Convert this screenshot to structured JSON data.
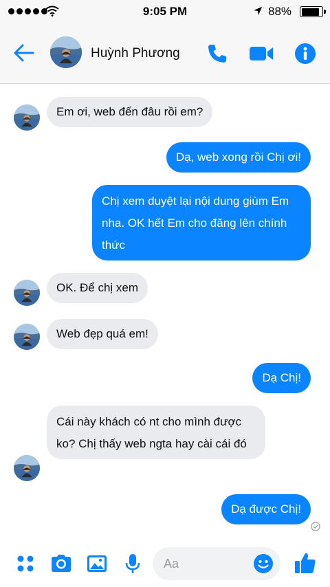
{
  "status_bar": {
    "time": "9:05 PM",
    "battery": "88%"
  },
  "header": {
    "contact_name": "Huỳnh Phương"
  },
  "messages": [
    {
      "direction": "in",
      "text": "Em ơi, web đến đâu rồi em?"
    },
    {
      "direction": "out",
      "text": "Dạ, web xong rồi Chị ơi!"
    },
    {
      "direction": "out",
      "text": "Chị xem duyệt lại nội dung giùm Em nha. OK hết Em cho đăng lên chính thức"
    },
    {
      "direction": "in",
      "text": "OK. Để chị xem"
    },
    {
      "direction": "in",
      "text": "Web đẹp quá em!"
    },
    {
      "direction": "out",
      "text": "Dạ Chị!"
    },
    {
      "direction": "in",
      "text": "Cái này khách có nt cho mình được ko? Chị thấy web ngta hay cài cái đó"
    },
    {
      "direction": "out",
      "text": "Dạ được Chị!"
    }
  ],
  "composer": {
    "placeholder": "Aa"
  },
  "colors": {
    "accent": "#0a84ff",
    "incoming_bubble": "#e9ebef",
    "header_bg": "#f7f7f7"
  },
  "icons": [
    "back-arrow-icon",
    "phone-icon",
    "video-camera-icon",
    "info-icon",
    "apps-grid-icon",
    "camera-icon",
    "image-icon",
    "microphone-icon",
    "emoji-icon",
    "thumbs-up-icon",
    "seen-check-icon"
  ]
}
